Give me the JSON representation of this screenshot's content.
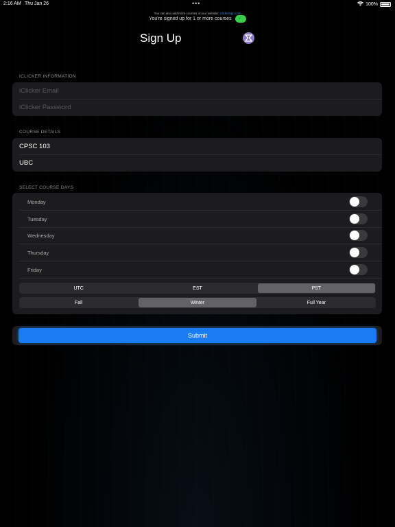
{
  "status_bar": {
    "time": "2:16 AM",
    "date": "Thu Jan 26",
    "dots": "•••",
    "battery": "100%"
  },
  "banner": {
    "line1": "You're signed up for 1 or more courses",
    "line2_prefix": "You can also add more courses on our website:",
    "line2_link": "iclickerapp.com"
  },
  "header": {
    "title": "Sign Up",
    "logo_glyph": "🀫"
  },
  "iclicker_section": {
    "label": "ICLICKER INFORMATION",
    "email_placeholder": "iClicker Email",
    "password_placeholder": "iClicker Password"
  },
  "course_section": {
    "label": "COURSE DETAILS",
    "course_value": "CPSC 103",
    "school_value": "UBC"
  },
  "days_section": {
    "label": "SELECT COURSE DAYS",
    "days": [
      {
        "label": "Monday",
        "on": false
      },
      {
        "label": "Tuesday",
        "on": false
      },
      {
        "label": "Wednesday",
        "on": false
      },
      {
        "label": "Thursday",
        "on": false
      },
      {
        "label": "Friday",
        "on": false
      }
    ],
    "timezones": [
      "UTC",
      "EST",
      "PST"
    ],
    "selected_timezone": "PST",
    "terms": [
      "Fall",
      "Winter",
      "Full Year"
    ],
    "selected_term": "Winter"
  },
  "submit_label": "Submit",
  "colors": {
    "accent": "#1a7cf3",
    "card": "#1c1c1e",
    "success": "#3ccf4e"
  }
}
